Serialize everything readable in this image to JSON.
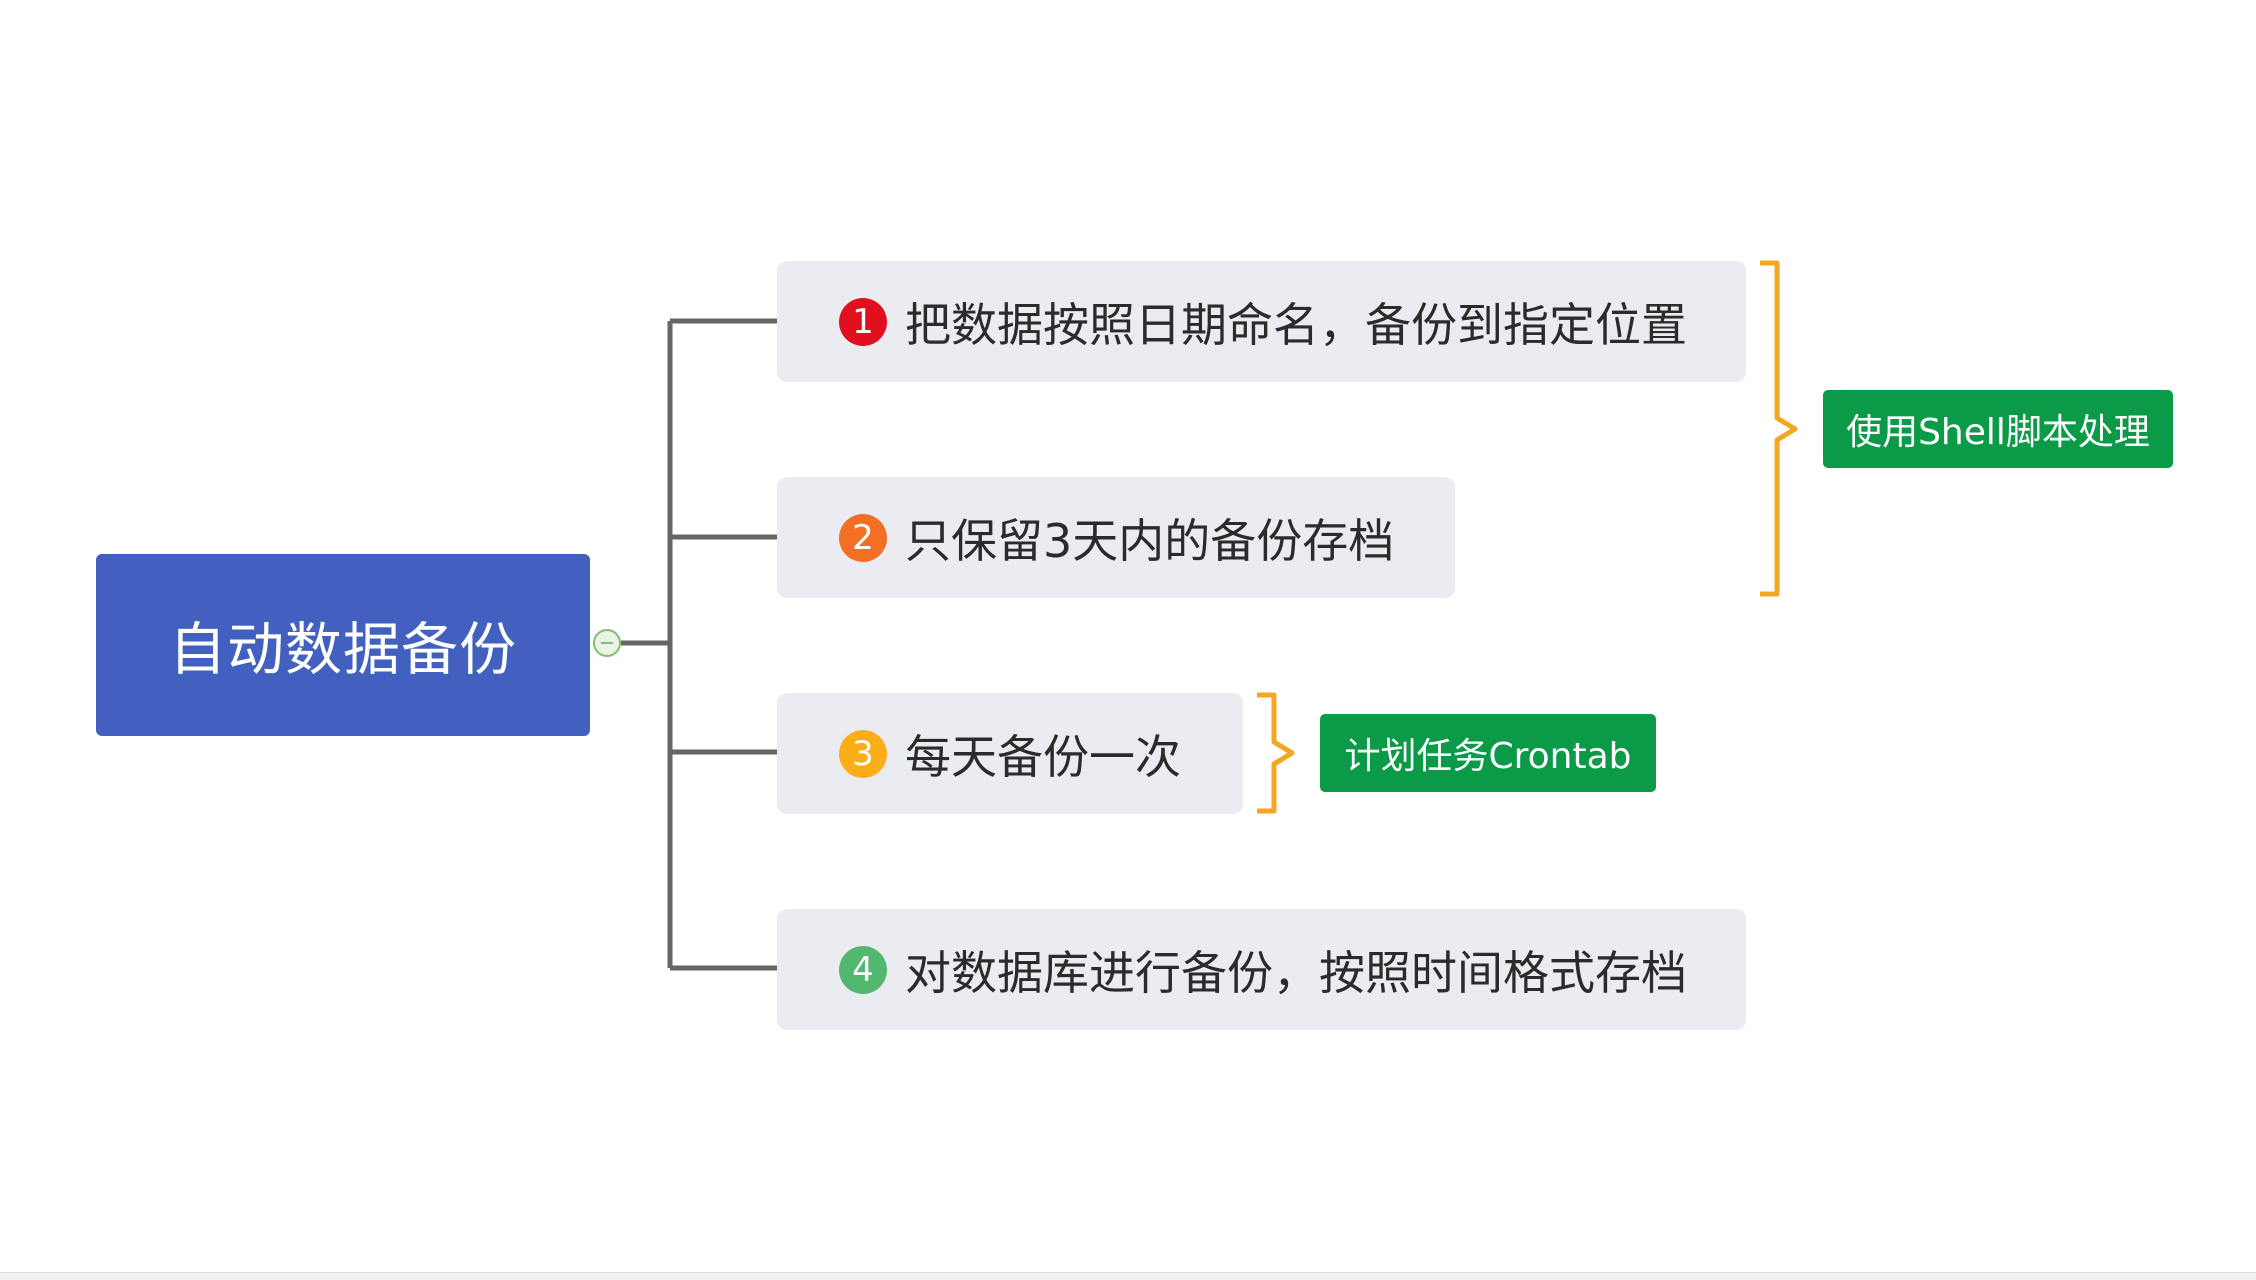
{
  "root": {
    "label": "自动数据备份"
  },
  "branches": [
    {
      "marker": "1",
      "label": "把数据按照日期命名，备份到指定位置",
      "marker_color": "#e0101e"
    },
    {
      "marker": "2",
      "label": "只保留3天内的备份存档",
      "marker_color": "#f36f23"
    },
    {
      "marker": "3",
      "label": "每天备份一次",
      "marker_color": "#fbae17"
    },
    {
      "marker": "4",
      "label": "对数据库进行备份，按照时间格式存档",
      "marker_color": "#52b86f"
    }
  ],
  "summaries": [
    {
      "label": "使用Shell脚本处理",
      "covers": [
        1,
        2
      ]
    },
    {
      "label": "计划任务Crontab",
      "covers": [
        3
      ]
    }
  ],
  "colors": {
    "root_fill": "#4160bf",
    "branch_fill": "#ebebf2",
    "connector": "#666666",
    "bracket": "#f5a623",
    "summary_fill": "#0b9a48"
  }
}
